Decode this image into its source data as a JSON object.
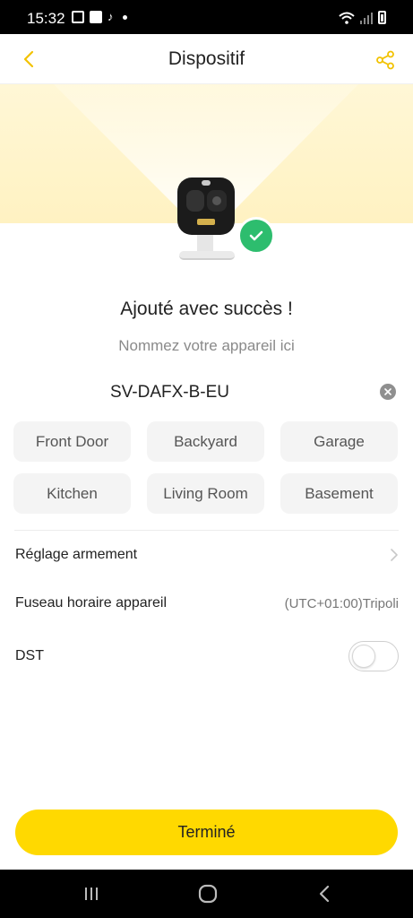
{
  "status_bar": {
    "time": "15:32",
    "left_icons": [
      "gallery-icon",
      "app-icon",
      "tiktok-icon",
      "dot-icon"
    ],
    "right_icons": [
      "wifi-icon",
      "signal-icon",
      "battery-icon"
    ]
  },
  "header": {
    "title": "Dispositif",
    "back_icon": "chevron-left-icon",
    "share_icon": "share-icon",
    "accent_color": "#f2c200"
  },
  "hero": {
    "success_icon": "check-icon",
    "success_color": "#2dbd6e"
  },
  "main": {
    "success_title": "Ajouté avec succès !",
    "name_hint": "Nommez votre appareil ici",
    "device_name": "SV-DAFX-B-EU",
    "suggestions": [
      "Front Door",
      "Backyard",
      "Garage",
      "Kitchen",
      "Living Room",
      "Basement"
    ]
  },
  "settings": {
    "arming_label": "Réglage armement",
    "timezone_label": "Fuseau horaire appareil",
    "timezone_value": "(UTC+01:00)Tripoli",
    "dst_label": "DST",
    "dst_enabled": false
  },
  "footer": {
    "done_label": "Terminé",
    "button_color": "#ffd900"
  },
  "nav_bar": {
    "buttons": [
      "recents-icon",
      "home-icon",
      "back-icon"
    ]
  }
}
